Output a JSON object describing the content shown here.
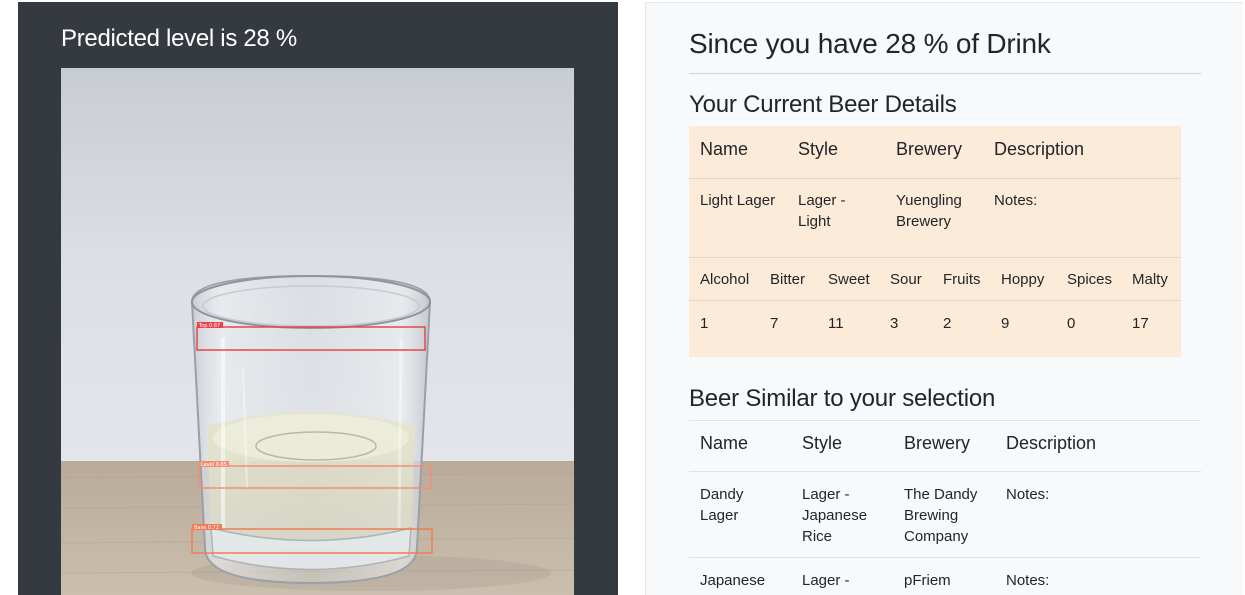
{
  "left": {
    "title": "Predicted level is 28 %",
    "detections": [
      {
        "label": "Top 0.87"
      },
      {
        "label": "Level 0.85"
      },
      {
        "label": "Base 0.72"
      }
    ]
  },
  "right": {
    "title": "Since you have 28 % of Drink",
    "current_section_title": "Your Current Beer Details",
    "current_table": {
      "headers": [
        "Name",
        "Style",
        "Brewery",
        "Description"
      ],
      "row": [
        "Light Lager",
        "Lager - Light",
        "Yuengling Brewery",
        "Notes:"
      ],
      "flavor_headers": [
        "Alcohol",
        "Bitter",
        "Sweet",
        "Sour",
        "Fruits",
        "Hoppy",
        "Spices",
        "Malty"
      ],
      "flavor_values": [
        "1",
        "7",
        "11",
        "3",
        "2",
        "9",
        "0",
        "17"
      ]
    },
    "similar_section_title": "Beer Similar to your selection",
    "similar_table": {
      "headers": [
        "Name",
        "Style",
        "Brewery",
        "Description"
      ],
      "rows": [
        [
          "Dandy Lager",
          "Lager - Japanese Rice",
          "The Dandy Brewing Company",
          "Notes:"
        ],
        [
          "Japanese",
          "Lager -",
          "pFriem",
          "Notes:"
        ]
      ]
    }
  },
  "colors": {
    "dark_panel": "#343a40",
    "light_panel": "#f8f9fa",
    "details_bg": "#fdebd9",
    "box_red": "#e8454a",
    "box_salmon": "#f28e78",
    "box_orange": "#ee7d57"
  }
}
